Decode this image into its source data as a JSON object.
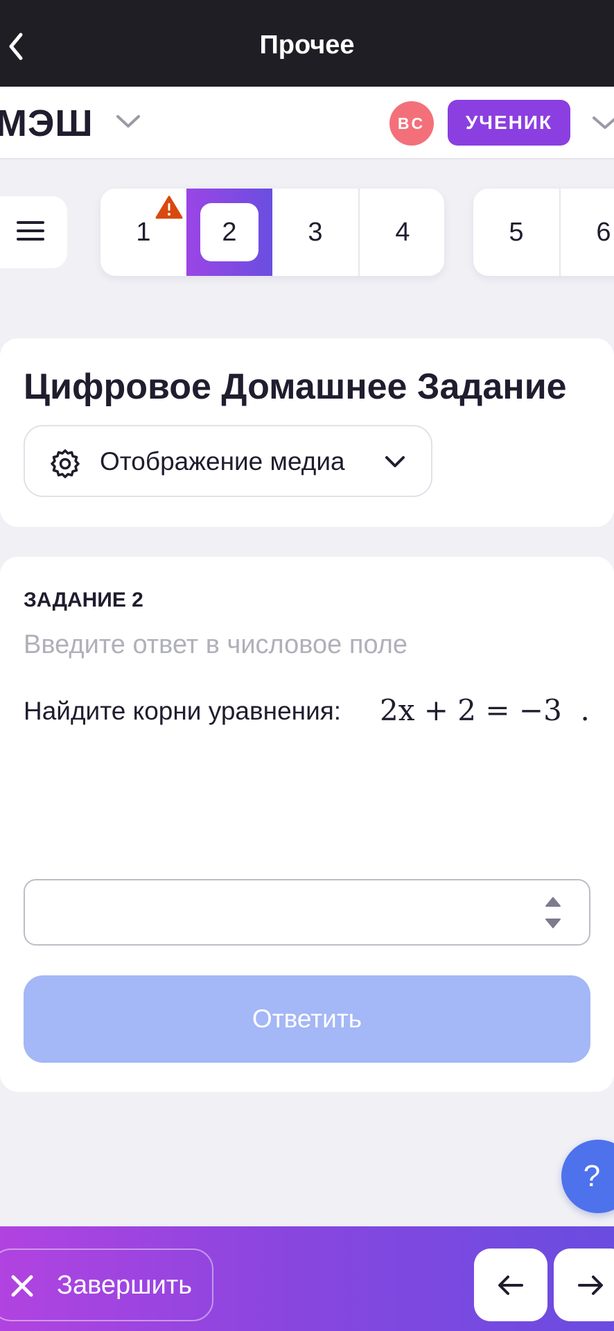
{
  "topbar": {
    "title": "Прочее"
  },
  "brand": {
    "name": "МЭШ"
  },
  "user": {
    "initials": "ВС",
    "role": "УЧЕНИК"
  },
  "tasks": {
    "items": [
      "1",
      "2",
      "3",
      "4",
      "5",
      "6"
    ],
    "active": "2",
    "warning_on": "1"
  },
  "header": {
    "title": "Цифровое Домашнее Задание",
    "media_label": "Отображение медиа"
  },
  "task": {
    "label": "ЗАДАНИЕ 2",
    "hint": "Введите ответ в числовое поле",
    "question": "Найдите корни уравнения:",
    "equation": "2x + 2 = −3",
    "answer_value": "",
    "submit_label": "Ответить"
  },
  "help": {
    "label": "?"
  },
  "footer": {
    "finish_label": "Завершить"
  },
  "colors": {
    "accent_purple": "#8b3fe0",
    "avatar": "#f3707a",
    "submit_disabled": "#a4b7f6",
    "help": "#4e72ec",
    "warning": "#d9480f"
  }
}
